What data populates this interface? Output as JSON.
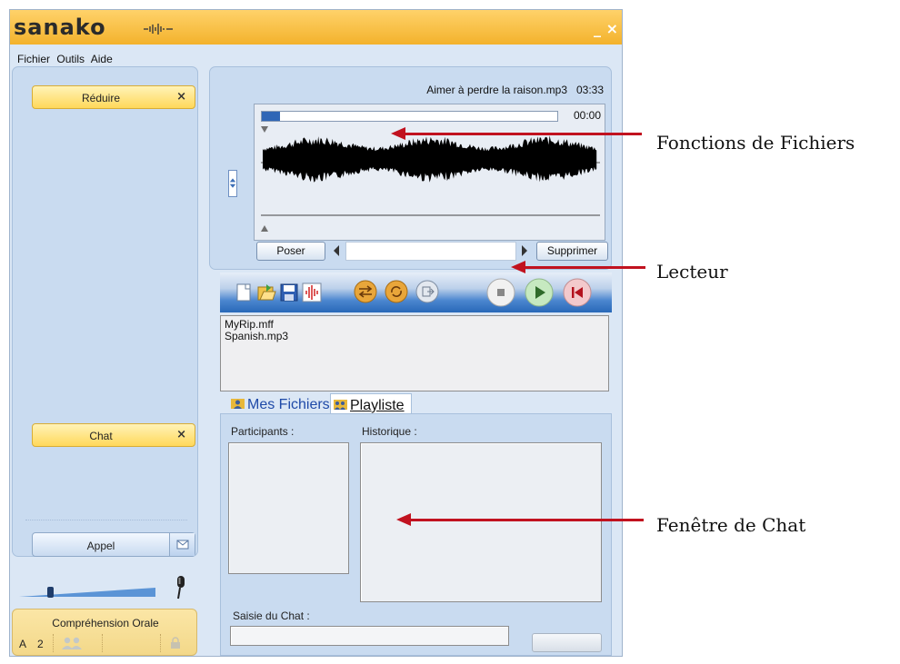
{
  "app": {
    "logo_text": "sanako",
    "window_buttons": "_ ×",
    "menu": [
      "Fichier",
      "Outils",
      "Aide"
    ]
  },
  "left": {
    "reduire_label": "Réduire",
    "chat_label": "Chat",
    "close_glyph": "×",
    "appel_label": "Appel",
    "volume_level": 0.22,
    "comprehension": {
      "title": "Compréhension Orale",
      "letter": "A",
      "number": "2"
    }
  },
  "player": {
    "track_title": "Aimer à perdre la raison.mp3",
    "track_duration": "03:33",
    "position_time": "00:00",
    "progress": 0.06,
    "poser_label": "Poser",
    "supprimer_label": "Supprimer"
  },
  "toolbar": {
    "icons": [
      "new-file-icon",
      "open-folder-icon",
      "save-icon",
      "waveform-icon",
      "shuffle-icon",
      "repeat-icon",
      "export-icon"
    ],
    "transport": [
      "stop-button",
      "play-button",
      "rewind-button"
    ]
  },
  "files": {
    "items": [
      "MyRip.mff",
      "Spanish.mp3"
    ]
  },
  "tabs": {
    "mes_fichiers": "Mes Fichiers",
    "playliste": "Playliste"
  },
  "chat": {
    "participants_label": "Participants :",
    "historique_label": "Historique :",
    "saisie_label": "Saisie du Chat :"
  },
  "annotations": {
    "fichiers": "Fonctions de Fichiers",
    "lecteur": "Lecteur",
    "chat": "Fenêtre de Chat"
  },
  "colors": {
    "title_bar": "#f3b22c",
    "arrow": "#c1121f",
    "panel": "#c9dbf0"
  }
}
